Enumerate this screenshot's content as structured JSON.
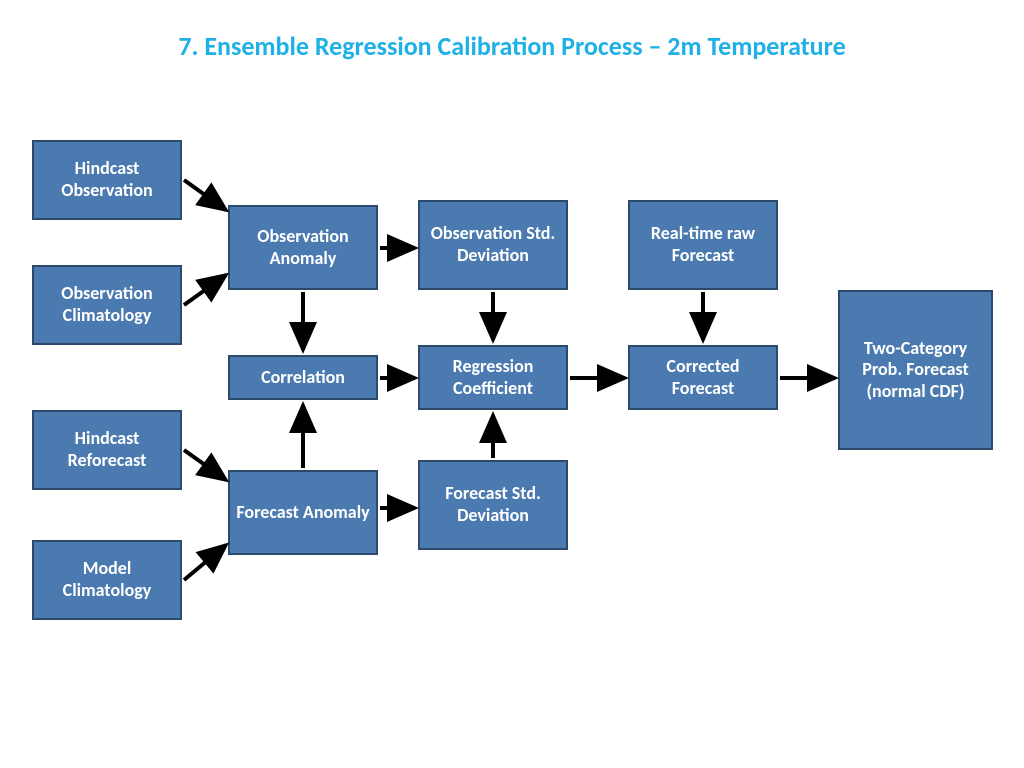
{
  "title": "7. Ensemble Regression Calibration Process – 2m Temperature",
  "boxes": {
    "hindcast_observation": "Hindcast Observation",
    "observation_climatology": "Observation Climatology",
    "hindcast_reforecast": "Hindcast Reforecast",
    "model_climatology": "Model Climatology",
    "observation_anomaly": "Observation Anomaly",
    "forecast_anomaly": "Forecast Anomaly",
    "correlation": "Correlation",
    "observation_std": "Observation Std. Deviation",
    "forecast_std": "Forecast Std. Deviation",
    "regression_coefficient": "Regression Coefficient",
    "realtime_raw_forecast": "Real-time raw Forecast",
    "corrected_forecast": "Corrected Forecast",
    "two_category": "Two-Category Prob. Forecast (normal CDF)"
  },
  "colors": {
    "box_fill": "#4a7ab0",
    "box_border": "#2c4a6b",
    "title": "#1eb0e6",
    "arrow": "#000000"
  }
}
